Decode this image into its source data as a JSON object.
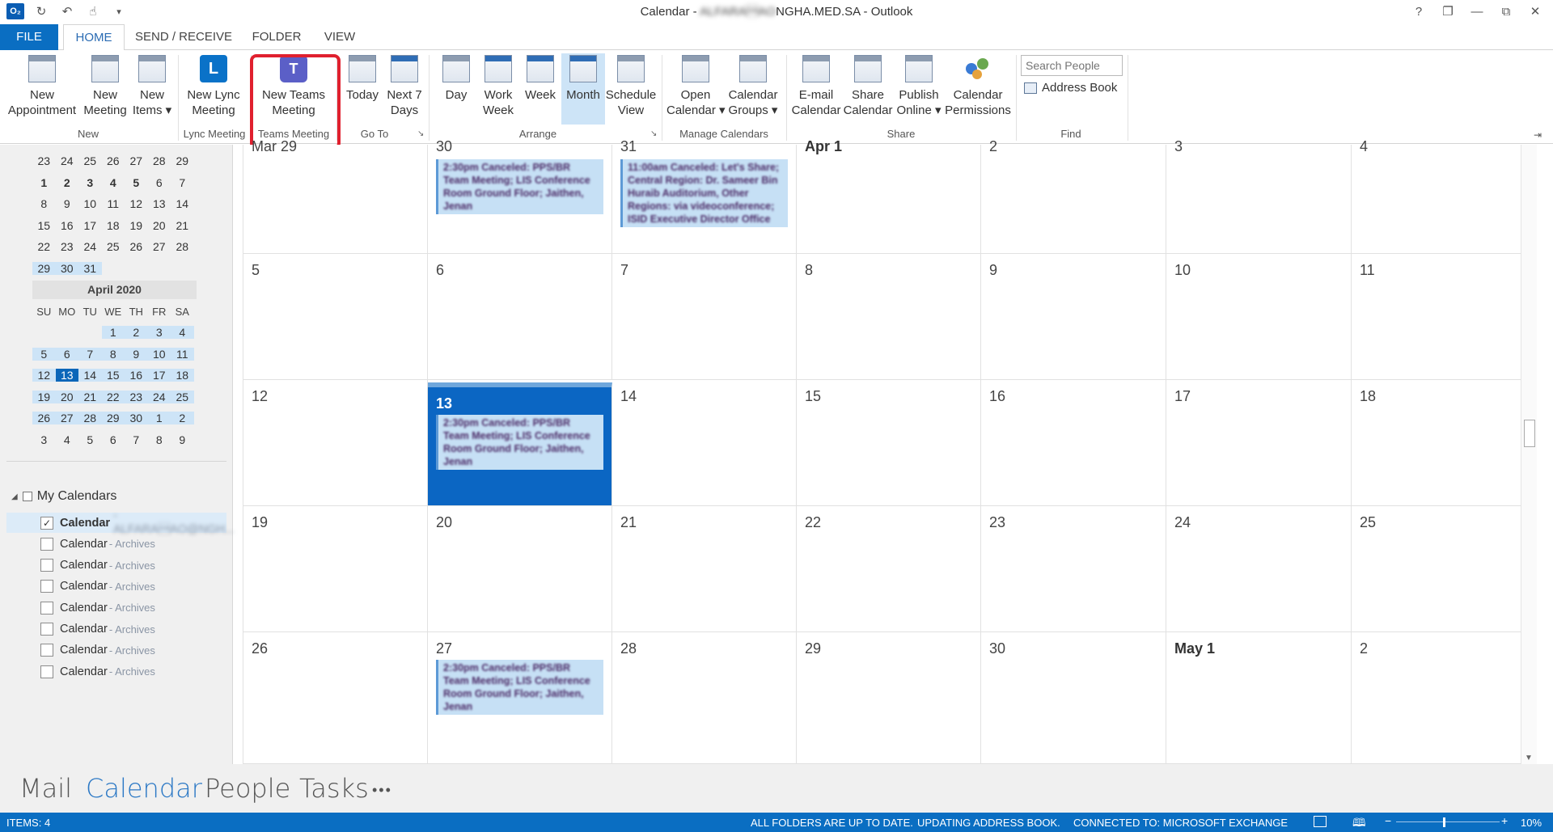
{
  "window": {
    "title_prefix": "Calendar - ",
    "title_blurred": "ALFARA\u0001AO",
    "title_suffix": "NGHA.MED.SA - Outlook",
    "controls": [
      "?",
      "❐",
      "—",
      "⧉",
      "✕"
    ]
  },
  "qat": {
    "logo": "O₂"
  },
  "tabs": [
    "FILE",
    "HOME",
    "SEND / RECEIVE",
    "FOLDER",
    "VIEW"
  ],
  "ribbon": {
    "new_appointment": [
      "New",
      "Appointment"
    ],
    "new_meeting": [
      "New",
      "Meeting"
    ],
    "new_items": [
      "New",
      "Items ▾"
    ],
    "new_lync": [
      "New Lync",
      "Meeting"
    ],
    "new_teams": [
      "New Teams",
      "Meeting"
    ],
    "today": [
      "Today",
      ""
    ],
    "next7": [
      "Next 7",
      "Days"
    ],
    "day": [
      "Day",
      ""
    ],
    "work_week": [
      "Work",
      "Week"
    ],
    "week": [
      "Week",
      ""
    ],
    "month": [
      "Month",
      ""
    ],
    "schedule_view": [
      "Schedule",
      "View"
    ],
    "open_calendar": [
      "Open",
      "Calendar ▾"
    ],
    "calendar_groups": [
      "Calendar",
      "Groups ▾"
    ],
    "email_calendar": [
      "E-mail",
      "Calendar"
    ],
    "share_calendar": [
      "Share",
      "Calendar"
    ],
    "publish_online": [
      "Publish",
      "Online ▾"
    ],
    "calendar_permissions": [
      "Calendar",
      "Permissions"
    ],
    "search_placeholder": "Search People",
    "address_book": "Address Book",
    "groups": {
      "new": "New",
      "lync": "Lync Meeting",
      "teams": "Teams Meeting",
      "goto": "Go To",
      "arrange": "Arrange",
      "manage": "Manage Calendars",
      "share": "Share",
      "find": "Find"
    }
  },
  "mini_cal": {
    "march_rows": [
      [
        "23",
        "24",
        "25",
        "26",
        "27",
        "28",
        "29"
      ],
      [
        "1",
        "2",
        "3",
        "4",
        "5",
        "6",
        "7"
      ],
      [
        "8",
        "9",
        "10",
        "11",
        "12",
        "13",
        "14"
      ],
      [
        "15",
        "16",
        "17",
        "18",
        "19",
        "20",
        "21"
      ],
      [
        "22",
        "23",
        "24",
        "25",
        "26",
        "27",
        "28"
      ],
      [
        "29",
        "30",
        "31",
        "",
        "",
        "",
        ""
      ]
    ],
    "april_title": "April 2020",
    "dow": [
      "SU",
      "MO",
      "TU",
      "WE",
      "TH",
      "FR",
      "SA"
    ],
    "april_rows": [
      [
        "",
        "",
        "",
        "1",
        "2",
        "3",
        "4"
      ],
      [
        "5",
        "6",
        "7",
        "8",
        "9",
        "10",
        "11"
      ],
      [
        "12",
        "13",
        "14",
        "15",
        "16",
        "17",
        "18"
      ],
      [
        "19",
        "20",
        "21",
        "22",
        "23",
        "24",
        "25"
      ],
      [
        "26",
        "27",
        "28",
        "29",
        "30",
        "1",
        "2"
      ],
      [
        "3",
        "4",
        "5",
        "6",
        "7",
        "8",
        "9"
      ]
    ]
  },
  "folders": {
    "header": "My Calendars",
    "items": [
      {
        "name": "Calendar",
        "suffix": "- ALFARA\u0001AO@NGH...",
        "checked": "✓"
      },
      {
        "name": "Calendar",
        "suffix": "- Archives",
        "checked": ""
      },
      {
        "name": "Calendar",
        "suffix": "- Archives",
        "checked": ""
      },
      {
        "name": "Calendar",
        "suffix": "- Archives",
        "checked": ""
      },
      {
        "name": "Calendar",
        "suffix": "- Archives",
        "checked": ""
      },
      {
        "name": "Calendar",
        "suffix": "- Archives",
        "checked": ""
      },
      {
        "name": "Calendar",
        "suffix": "- Archives",
        "checked": ""
      },
      {
        "name": "Calendar",
        "suffix": "- Archives",
        "checked": ""
      }
    ]
  },
  "calendar": {
    "weeks": [
      [
        "Mar 29",
        "30",
        "31",
        "Apr 1",
        "2",
        "3",
        "4"
      ],
      [
        "5",
        "6",
        "7",
        "8",
        "9",
        "10",
        "11"
      ],
      [
        "12",
        "13",
        "14",
        "15",
        "16",
        "17",
        "18"
      ],
      [
        "19",
        "20",
        "21",
        "22",
        "23",
        "24",
        "25"
      ],
      [
        "26",
        "27",
        "28",
        "29",
        "30",
        "May 1",
        "2"
      ]
    ],
    "events": [
      {
        "week": 0,
        "day": 1,
        "text": "2:30pm Canceled: PPS/BR Team Meeting; LIS Conference Room Ground Floor; Jaithen, Jenan"
      },
      {
        "week": 0,
        "day": 2,
        "text": "11:00am Canceled: Let's Share; Central Region: Dr. Sameer Bin Huraib Auditorium, Other Regions: via videoconference; ISID Executive Director Office"
      },
      {
        "week": 2,
        "day": 1,
        "text": "2:30pm Canceled: PPS/BR Team Meeting; LIS Conference Room Ground Floor; Jaithen, Jenan"
      },
      {
        "week": 4,
        "day": 1,
        "text": "2:30pm Canceled: PPS/BR Team Meeting; LIS Conference Room Ground Floor; Jaithen, Jenan"
      }
    ],
    "today": {
      "week": 2,
      "day": 1
    }
  },
  "peek": [
    "Mail",
    "Calendar",
    "People",
    "Tasks",
    "•••"
  ],
  "status": {
    "items": "ITEMS: 4",
    "folders": "ALL FOLDERS ARE UP TO DATE.",
    "updating": "UPDATING ADDRESS BOOK.",
    "connected": "CONNECTED TO: MICROSOFT EXCHANGE",
    "zoom": "10%"
  }
}
